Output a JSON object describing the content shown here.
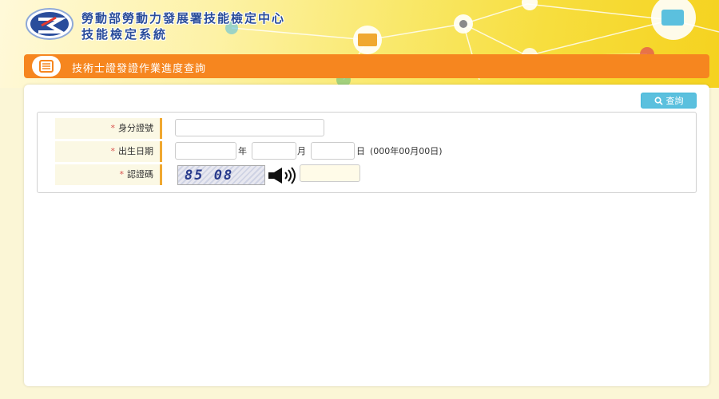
{
  "header": {
    "org_title": "勞動部勞動力發展署技能檢定中心",
    "system_title": "技能檢定系統"
  },
  "banner": {
    "title": "技術士證發證作業進度查詢",
    "icon": "list-doc-icon",
    "color": "#f6861f"
  },
  "toolbar": {
    "query_label": "查詢",
    "query_icon": "search-icon"
  },
  "form": {
    "id_number": {
      "label": "身分證號",
      "required_mark": "*",
      "value": ""
    },
    "birth_date": {
      "label": "出生日期",
      "required_mark": "*",
      "year_value": "",
      "year_unit": "年",
      "month_value": "",
      "month_unit": "月",
      "day_value": "",
      "day_unit": "日",
      "hint": "(000年00月00日)"
    },
    "captcha": {
      "label": "認證碼",
      "required_mark": "*",
      "image_text": "85 08",
      "audio_icon": "speaker-icon",
      "value": ""
    }
  },
  "colors": {
    "accent": "#f6861f",
    "label_bar": "#f0a830",
    "button": "#5bc0de",
    "title": "#2a4d9b"
  }
}
